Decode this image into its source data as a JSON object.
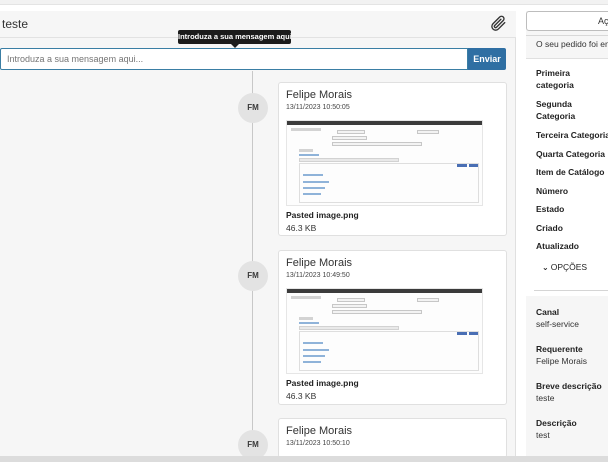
{
  "main": {
    "title": "teste",
    "attach_icon": "paperclip-icon",
    "tooltip": "Introduza a sua mensagem aqui...",
    "message_input_placeholder": "Introduza a sua mensagem aqui...",
    "send_label": "Enviar"
  },
  "activity": [
    {
      "initials": "FM",
      "author": "Felipe Morais",
      "timestamp": "13/11/2023 10:50:05",
      "filename": "Pasted image.png",
      "filesize": "46.3 KB"
    },
    {
      "initials": "FM",
      "author": "Felipe Morais",
      "timestamp": "13/11/2023 10:49:50",
      "filename": "Pasted image.png",
      "filesize": "46.3 KB"
    },
    {
      "initials": "FM",
      "author": "Felipe Morais",
      "timestamp": "13/11/2023 10:50:10"
    }
  ],
  "sidebar": {
    "actions_label": "Açõ",
    "submitted_message": "O seu pedido foi env",
    "details_labels": [
      "Primeira categoria",
      "Segunda Categoria",
      "Terceira Categoria",
      "Quarta Categoria",
      "Item de Catálogo",
      "Número",
      "Estado",
      "Criado",
      "Atualizado"
    ],
    "options_label": "OPÇÕES",
    "info": [
      {
        "label": "Canal",
        "value": "self-service"
      },
      {
        "label": "Requerente",
        "value": "Felipe Morais"
      },
      {
        "label": "Breve descrição",
        "value": "teste"
      },
      {
        "label": "Descrição",
        "value": "test"
      }
    ]
  },
  "colors": {
    "accent": "#2f6fa3",
    "input_border": "#3a7ea4",
    "tooltip_bg": "#1b1b1b"
  }
}
